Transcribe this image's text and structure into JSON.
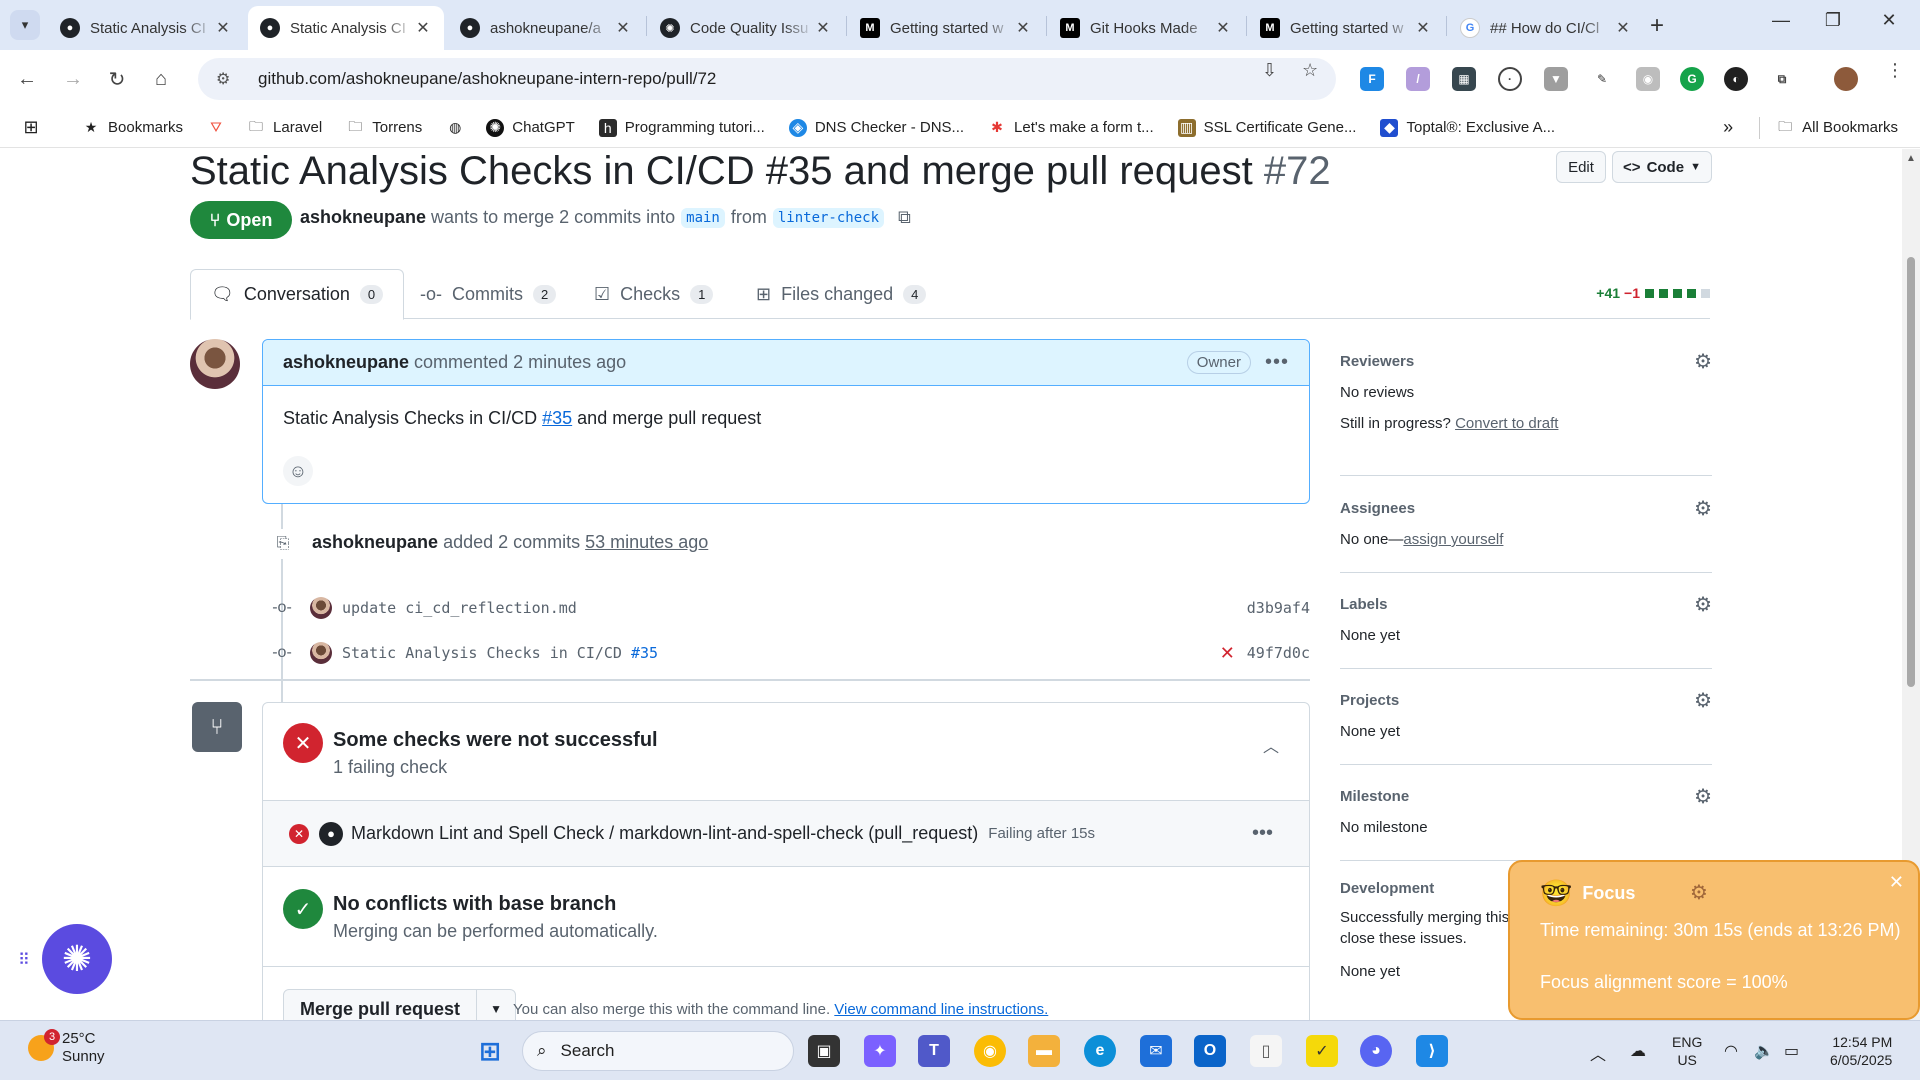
{
  "browser": {
    "tabs": [
      {
        "title": "Static Analysis CI",
        "favicon": "github-icon",
        "color": "#1f2328",
        "active": false
      },
      {
        "title": "Static Analysis CI",
        "favicon": "github-icon",
        "color": "#1f2328",
        "active": true
      },
      {
        "title": "ashokneupane/a",
        "favicon": "github-icon",
        "color": "#1f2328",
        "active": false
      },
      {
        "title": "Code Quality Issu",
        "favicon": "chatgpt-icon",
        "color": "#1f2328",
        "active": false
      },
      {
        "title": "Getting started w",
        "favicon": "medium-icon",
        "color": "#000000",
        "active": false
      },
      {
        "title": "Git Hooks Made",
        "favicon": "medium-icon",
        "color": "#000000",
        "active": false
      },
      {
        "title": "Getting started w",
        "favicon": "medium-icon",
        "color": "#000000",
        "active": false
      },
      {
        "title": "## How do CI/Cl",
        "favicon": "google-icon",
        "color": "#4285f4",
        "active": false
      }
    ],
    "url": "github.com/ashokneupane/ashokneupane-intern-repo/pull/72",
    "bookmarks": [
      {
        "label": "Bookmarks",
        "icon": "star-icon"
      },
      {
        "label": "",
        "icon": "laravel-icon"
      },
      {
        "label": "Laravel",
        "icon": "folder-icon"
      },
      {
        "label": "Torrens",
        "icon": "folder-icon"
      },
      {
        "label": "",
        "icon": "globe-icon"
      },
      {
        "label": "ChatGPT",
        "icon": "chatgpt-icon"
      },
      {
        "label": "Programming tutori...",
        "icon": "h-icon"
      },
      {
        "label": "DNS Checker - DNS...",
        "icon": "shield-icon"
      },
      {
        "label": "Let's make a form t...",
        "icon": "asterisk-icon"
      },
      {
        "label": "SSL Certificate Gene...",
        "icon": "ssl-icon"
      },
      {
        "label": "Toptal®: Exclusive A...",
        "icon": "toptal-icon"
      }
    ],
    "all_bookmarks": "All Bookmarks"
  },
  "pr": {
    "title": "Static Analysis Checks in CI/CD #35 and merge pull request",
    "number": "#72",
    "edit_label": "Edit",
    "code_label": "Code",
    "state": "Open",
    "author": "ashokneupane",
    "meta_text": "wants to merge 2 commits into",
    "base_branch": "main",
    "from_text": "from",
    "head_branch": "linter-check",
    "tabs": [
      {
        "label": "Conversation",
        "count": "0",
        "icon": "conversation-icon"
      },
      {
        "label": "Commits",
        "count": "2",
        "icon": "commit-icon"
      },
      {
        "label": "Checks",
        "count": "1",
        "icon": "checklist-icon"
      },
      {
        "label": "Files changed",
        "count": "4",
        "icon": "file-diff-icon"
      }
    ],
    "additions": "+41",
    "deletions": "−1"
  },
  "comment": {
    "author": "ashokneupane",
    "action": "commented 2 minutes ago",
    "role": "Owner",
    "body_before": "Static Analysis Checks in CI/CD",
    "body_link": "#35",
    "body_after": "and merge pull request"
  },
  "commit_event": {
    "author": "ashokneupane",
    "action": "added 2 commits",
    "time": "53 minutes ago",
    "commits": [
      {
        "message": "update ci_cd_reflection.md",
        "link": "",
        "sha": "d3b9af4",
        "failed": false
      },
      {
        "message": "Static Analysis Checks in CI/CD",
        "link": "#35",
        "sha": "49f7d0c",
        "failed": true
      }
    ]
  },
  "merge": {
    "checks_title": "Some checks were not successful",
    "checks_sub": "1 failing check",
    "check_name": "Markdown Lint and Spell Check / markdown-lint-and-spell-check (pull_request)",
    "check_status": "Failing after 15s",
    "conflicts_title": "No conflicts with base branch",
    "conflicts_sub": "Merging can be performed automatically.",
    "merge_button": "Merge pull request",
    "cmd_text": "You can also merge this with the command line.",
    "cmd_link": "View command line instructions."
  },
  "sidebar": {
    "reviewers": {
      "heading": "Reviewers",
      "value": "No reviews",
      "extra": "Still in progress?",
      "extra_link": "Convert to draft"
    },
    "assignees": {
      "heading": "Assignees",
      "value": "No one—",
      "link": "assign yourself"
    },
    "labels": {
      "heading": "Labels",
      "value": "None yet"
    },
    "projects": {
      "heading": "Projects",
      "value": "None yet"
    },
    "milestone": {
      "heading": "Milestone",
      "value": "No milestone"
    },
    "development": {
      "heading": "Development",
      "value": "Successfully merging this pull request may close these issues.",
      "value2": "None yet"
    }
  },
  "focus_widget": {
    "title": "Focus",
    "line1": "Time remaining: 30m 15s (ends at 13:26 PM)",
    "line2": "Focus alignment score = 100%"
  },
  "taskbar": {
    "weather_temp": "25°C",
    "weather_desc": "Sunny",
    "weather_badge": "3",
    "search_label": "Search",
    "lang1": "ENG",
    "lang2": "US",
    "time": "12:54 PM",
    "date": "6/05/2025"
  },
  "colors": {
    "open_green": "#1f883d",
    "link_blue": "#0969da",
    "fail_red": "#d1242f",
    "focus_orange": "#f8bf6f"
  }
}
